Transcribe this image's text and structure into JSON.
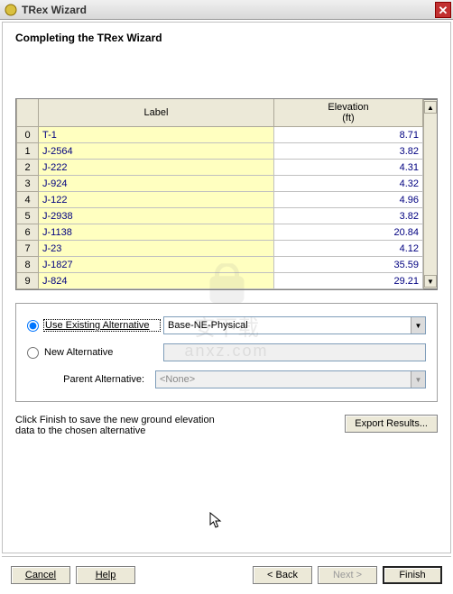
{
  "window": {
    "title": "TRex Wizard",
    "close_label": "✕"
  },
  "page": {
    "heading": "Completing the TRex Wizard"
  },
  "table": {
    "headers": {
      "label": "Label",
      "elevation": "Elevation\n(ft)"
    },
    "rows": [
      {
        "idx": "0",
        "label": "T-1",
        "elev": "8.71"
      },
      {
        "idx": "1",
        "label": "J-2564",
        "elev": "3.82"
      },
      {
        "idx": "2",
        "label": "J-222",
        "elev": "4.31"
      },
      {
        "idx": "3",
        "label": "J-924",
        "elev": "4.32"
      },
      {
        "idx": "4",
        "label": "J-122",
        "elev": "4.96"
      },
      {
        "idx": "5",
        "label": "J-2938",
        "elev": "3.82"
      },
      {
        "idx": "6",
        "label": "J-1138",
        "elev": "20.84"
      },
      {
        "idx": "7",
        "label": "J-23",
        "elev": "4.12"
      },
      {
        "idx": "8",
        "label": "J-1827",
        "elev": "35.59"
      },
      {
        "idx": "9",
        "label": "J-824",
        "elev": "29.21"
      }
    ]
  },
  "alt": {
    "use_existing": "Use Existing Alternative",
    "new_alt": "New Alternative",
    "existing_value": "Base-NE-Physical",
    "parent_label": "Parent Alternative:",
    "parent_value": "<None>"
  },
  "hint": {
    "text": "Click Finish to save the new ground elevation data to the chosen alternative",
    "export": "Export Results..."
  },
  "buttons": {
    "cancel": "Cancel",
    "help": "Help",
    "back": "< Back",
    "next": "Next >",
    "finish": "Finish"
  },
  "watermark": {
    "main": "安下载",
    "sub": "anxz.com"
  }
}
